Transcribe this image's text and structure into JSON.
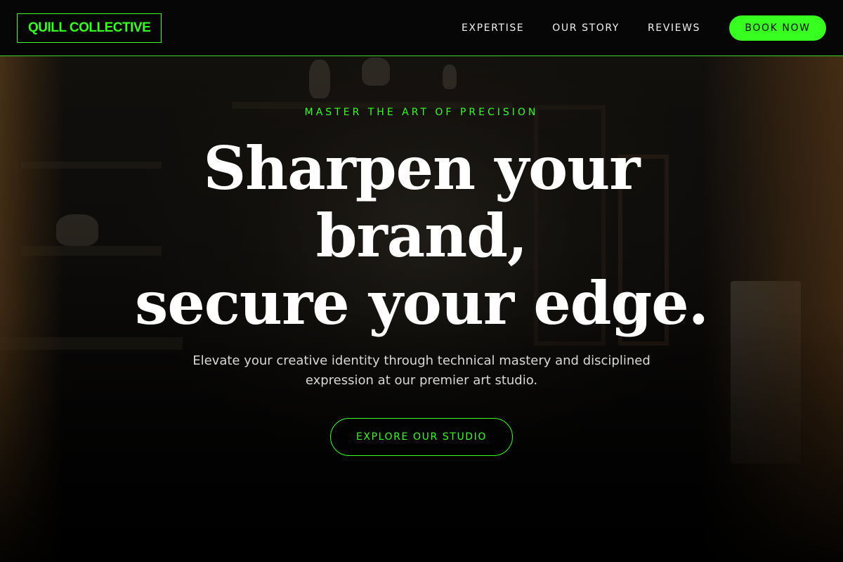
{
  "nav": {
    "logo": "QUILL COLLECTIVE",
    "links": [
      {
        "label": "EXPERTISE"
      },
      {
        "label": "OUR STORY"
      },
      {
        "label": "REVIEWS"
      }
    ],
    "book_label": "BOOK NOW"
  },
  "hero": {
    "eyebrow": "MASTER THE ART OF PRECISION",
    "headline_lines": [
      "Sharpen your",
      "brand,",
      "secure your edge."
    ],
    "subtext": "Elevate your creative identity through technical mastery and disciplined expression at our premier art studio.",
    "cta_label": "EXPLORE OUR STUDIO"
  },
  "colors": {
    "accent": "#37ff1f",
    "nav_background": "#060606",
    "text_primary": "#ffffff"
  }
}
